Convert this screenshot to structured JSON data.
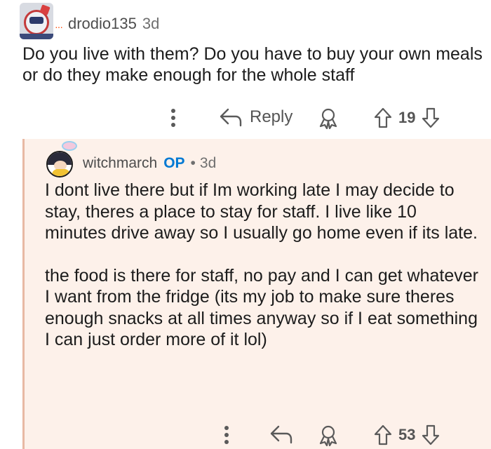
{
  "comment": {
    "username": "drodio135",
    "age": "3d",
    "body": "Do you live with them? Do you have to buy your own meals or do they make enough for the whole staff",
    "actions": {
      "more_icon": "vertical-dots-icon",
      "reply_label": "Reply",
      "award_icon": "award-icon",
      "score": "19"
    }
  },
  "reply": {
    "username": "witchmarch",
    "op_badge": "OP",
    "separator": "•",
    "age": "3d",
    "paragraphs": [
      "I dont live there but if Im working late I may decide to stay, theres a place to stay for staff. I live like 10 minutes drive away so I usually go home even if its late.",
      "the food is there for staff, no pay and I can get whatever I want from the fridge (its my job to make sure theres enough snacks at all times anyway so if I eat something I can just order more of it lol)"
    ],
    "actions": {
      "score": "53"
    }
  },
  "colors": {
    "reply_background": "#fdf1ea",
    "thread_line": "#e8b9a4",
    "op_badge": "#0079d3",
    "icon_gray": "#6a6a6a"
  }
}
